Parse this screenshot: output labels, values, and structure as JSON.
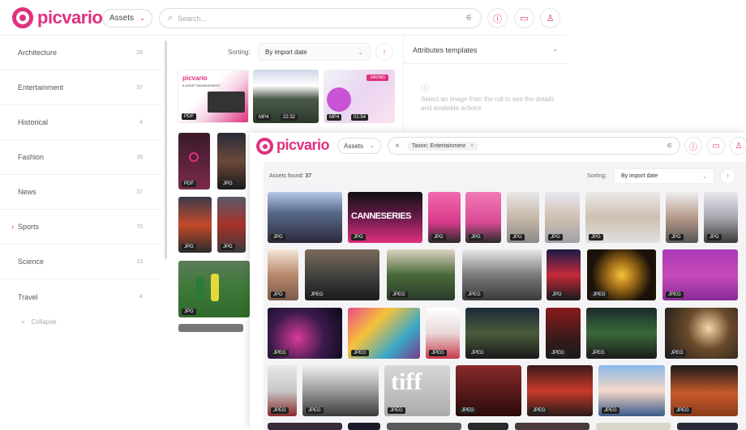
{
  "back": {
    "logo": "picvario",
    "assets_label": "Assets",
    "search_placeholder": "Search...",
    "categories": [
      {
        "label": "Architecture",
        "count": "28"
      },
      {
        "label": "Entertainment",
        "count": "37"
      },
      {
        "label": "Historical",
        "count": "4"
      },
      {
        "label": "Fashion",
        "count": "16"
      },
      {
        "label": "News",
        "count": "37"
      },
      {
        "label": "Sports",
        "count": "70"
      },
      {
        "label": "Science",
        "count": "13"
      },
      {
        "label": "Travel",
        "count": "4"
      }
    ],
    "collapse_label": "Collapse",
    "sorting_label": "Sorting:",
    "sorting_value": "By import date",
    "attributes_title": "Attributes templates",
    "attributes_hint": "Select an image from the roll to see the details and available actions",
    "thumbs": [
      {
        "badge": "PDF",
        "duration": ""
      },
      {
        "badge": "MP4",
        "duration": "22:32"
      },
      {
        "badge": "MP4",
        "duration": "01:54"
      },
      {
        "badge": "PDF",
        "duration": ""
      },
      {
        "badge": "JPG",
        "duration": ""
      },
      {
        "badge": "JPG",
        "duration": ""
      },
      {
        "badge": "JPG",
        "duration": ""
      },
      {
        "badge": "JPG",
        "duration": ""
      }
    ],
    "promo_brand": "picvario",
    "promo_subtitle": "& ASSET MANAGEMENT",
    "promo_saving": "SAVING"
  },
  "front": {
    "logo": "picvario",
    "assets_label": "Assets",
    "filter_tag": "Taxon: Entertainment",
    "assets_found_label": "Assets found:",
    "assets_found_count": "37",
    "sorting_label": "Sorting:",
    "sorting_value": "By import date",
    "rows": [
      [
        "JPG",
        "JPG",
        "JPG",
        "JPG",
        "JPG",
        "JPG",
        "JPG",
        "JPG",
        "JPG"
      ],
      [
        "JPG",
        "JPEG",
        "JPEG",
        "JPEG",
        "JPG",
        "JPEG",
        "JPEG"
      ],
      [
        "JPEG",
        "JPEG",
        "JPEG",
        "JPEG",
        "JPEG",
        "JPEG",
        "JPEG"
      ],
      [
        "JPEG",
        "JPEG",
        "JPEG",
        "JPEG",
        "JPEG",
        "JPEG",
        "JPEG"
      ]
    ],
    "banner_text": "CANNESERIES",
    "tiff_text": "tiff"
  },
  "colors": {
    "accent": "#e0307e"
  }
}
